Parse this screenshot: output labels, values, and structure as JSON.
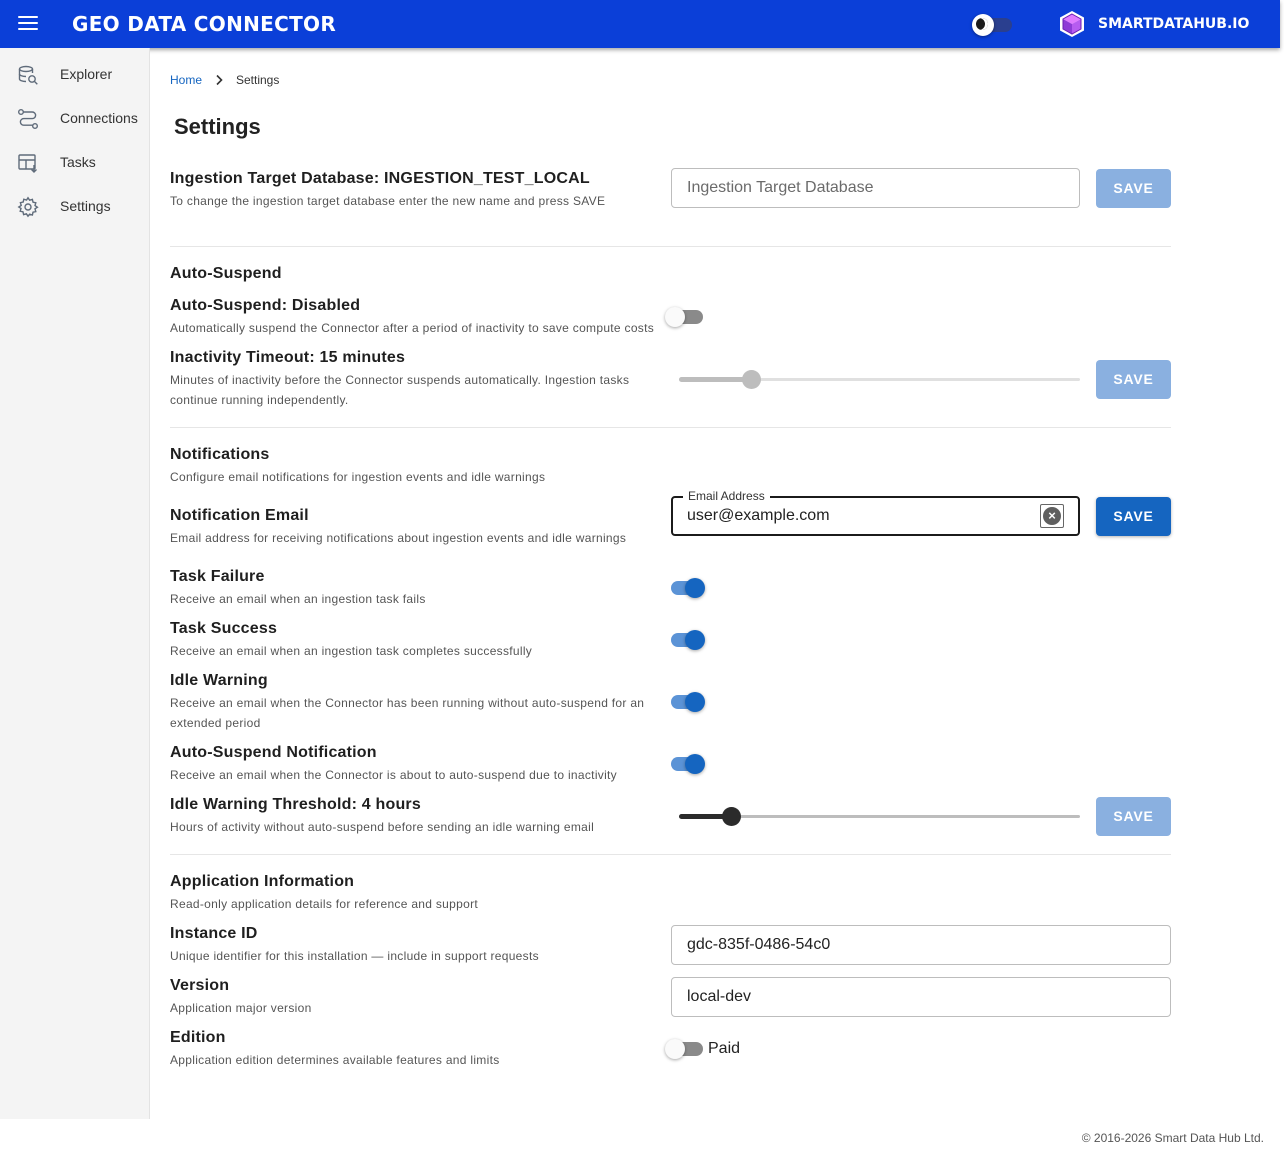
{
  "app": {
    "title": "GEO DATA CONNECTOR",
    "brand": "SMARTDATAHUB.IO",
    "theme_icon": "moon-toggle-icon",
    "menu_icon": "hamburger-menu-icon"
  },
  "sidebar": {
    "items": [
      {
        "label": "Explorer",
        "icon": "database-search-icon"
      },
      {
        "label": "Connections",
        "icon": "route-connections-icon"
      },
      {
        "label": "Tasks",
        "icon": "table-tasks-icon"
      },
      {
        "label": "Settings",
        "icon": "gear-icon"
      }
    ]
  },
  "breadcrumb": {
    "home": "Home",
    "current": "Settings"
  },
  "page_title": "Settings",
  "ingestion": {
    "title": "Ingestion Target Database: INGESTION_TEST_LOCAL",
    "desc": "To change the ingestion target database enter the new name and press SAVE",
    "placeholder": "Ingestion Target Database",
    "save_label": "SAVE"
  },
  "auto_suspend": {
    "section_title": "Auto-Suspend",
    "toggle_title": "Auto-Suspend: Disabled",
    "toggle_desc": "Automatically suspend the Connector after a period of inactivity to save compute costs",
    "enabled": false,
    "timeout_title": "Inactivity Timeout: 15 minutes",
    "timeout_desc_line1": "Minutes of inactivity before the Connector suspends automatically. Ingestion tasks",
    "timeout_desc_line2": "continue running independently.",
    "timeout_level": 0.18,
    "save_label": "SAVE"
  },
  "notifications": {
    "section_title": "Notifications",
    "section_desc": "Configure email notifications for ingestion events and idle warnings",
    "email_title": "Notification Email",
    "email_desc": "Email address for receiving notifications about ingestion events and idle warnings",
    "email_label": "Email Address",
    "email_value": "user@example.com",
    "email_save": "SAVE",
    "toggles": [
      {
        "title": "Task Failure",
        "desc": "Receive an email when an ingestion task fails",
        "on": true
      },
      {
        "title": "Task Success",
        "desc": "Receive an email when an ingestion task completes successfully",
        "on": true
      },
      {
        "title": "Idle Warning",
        "desc": "Receive an email when the Connector has been running without auto-suspend for an",
        "desc2": "extended period",
        "on": true
      },
      {
        "title": "Auto-Suspend Notification",
        "desc": "Receive an email when the Connector is about to auto-suspend due to inactivity",
        "on": true
      }
    ],
    "threshold_title": "Idle Warning Threshold: 4 hours",
    "threshold_desc": "Hours of activity without auto-suspend before sending an idle warning email",
    "threshold_level": 0.13,
    "threshold_save": "SAVE"
  },
  "app_info": {
    "section_title": "Application Information",
    "section_desc": "Read-only application details for reference and support",
    "instance_title": "Instance ID",
    "instance_desc": "Unique identifier for this installation — include in support requests",
    "instance_value": "gdc-835f-0486-54c0",
    "version_title": "Version",
    "version_desc": "Application major version",
    "version_value": "local-dev",
    "edition_title": "Edition",
    "edition_desc": "Application edition determines available features and limits",
    "edition_label": "Paid",
    "edition_on": false
  },
  "footer": "© 2016-2026 Smart Data Hub Ltd."
}
